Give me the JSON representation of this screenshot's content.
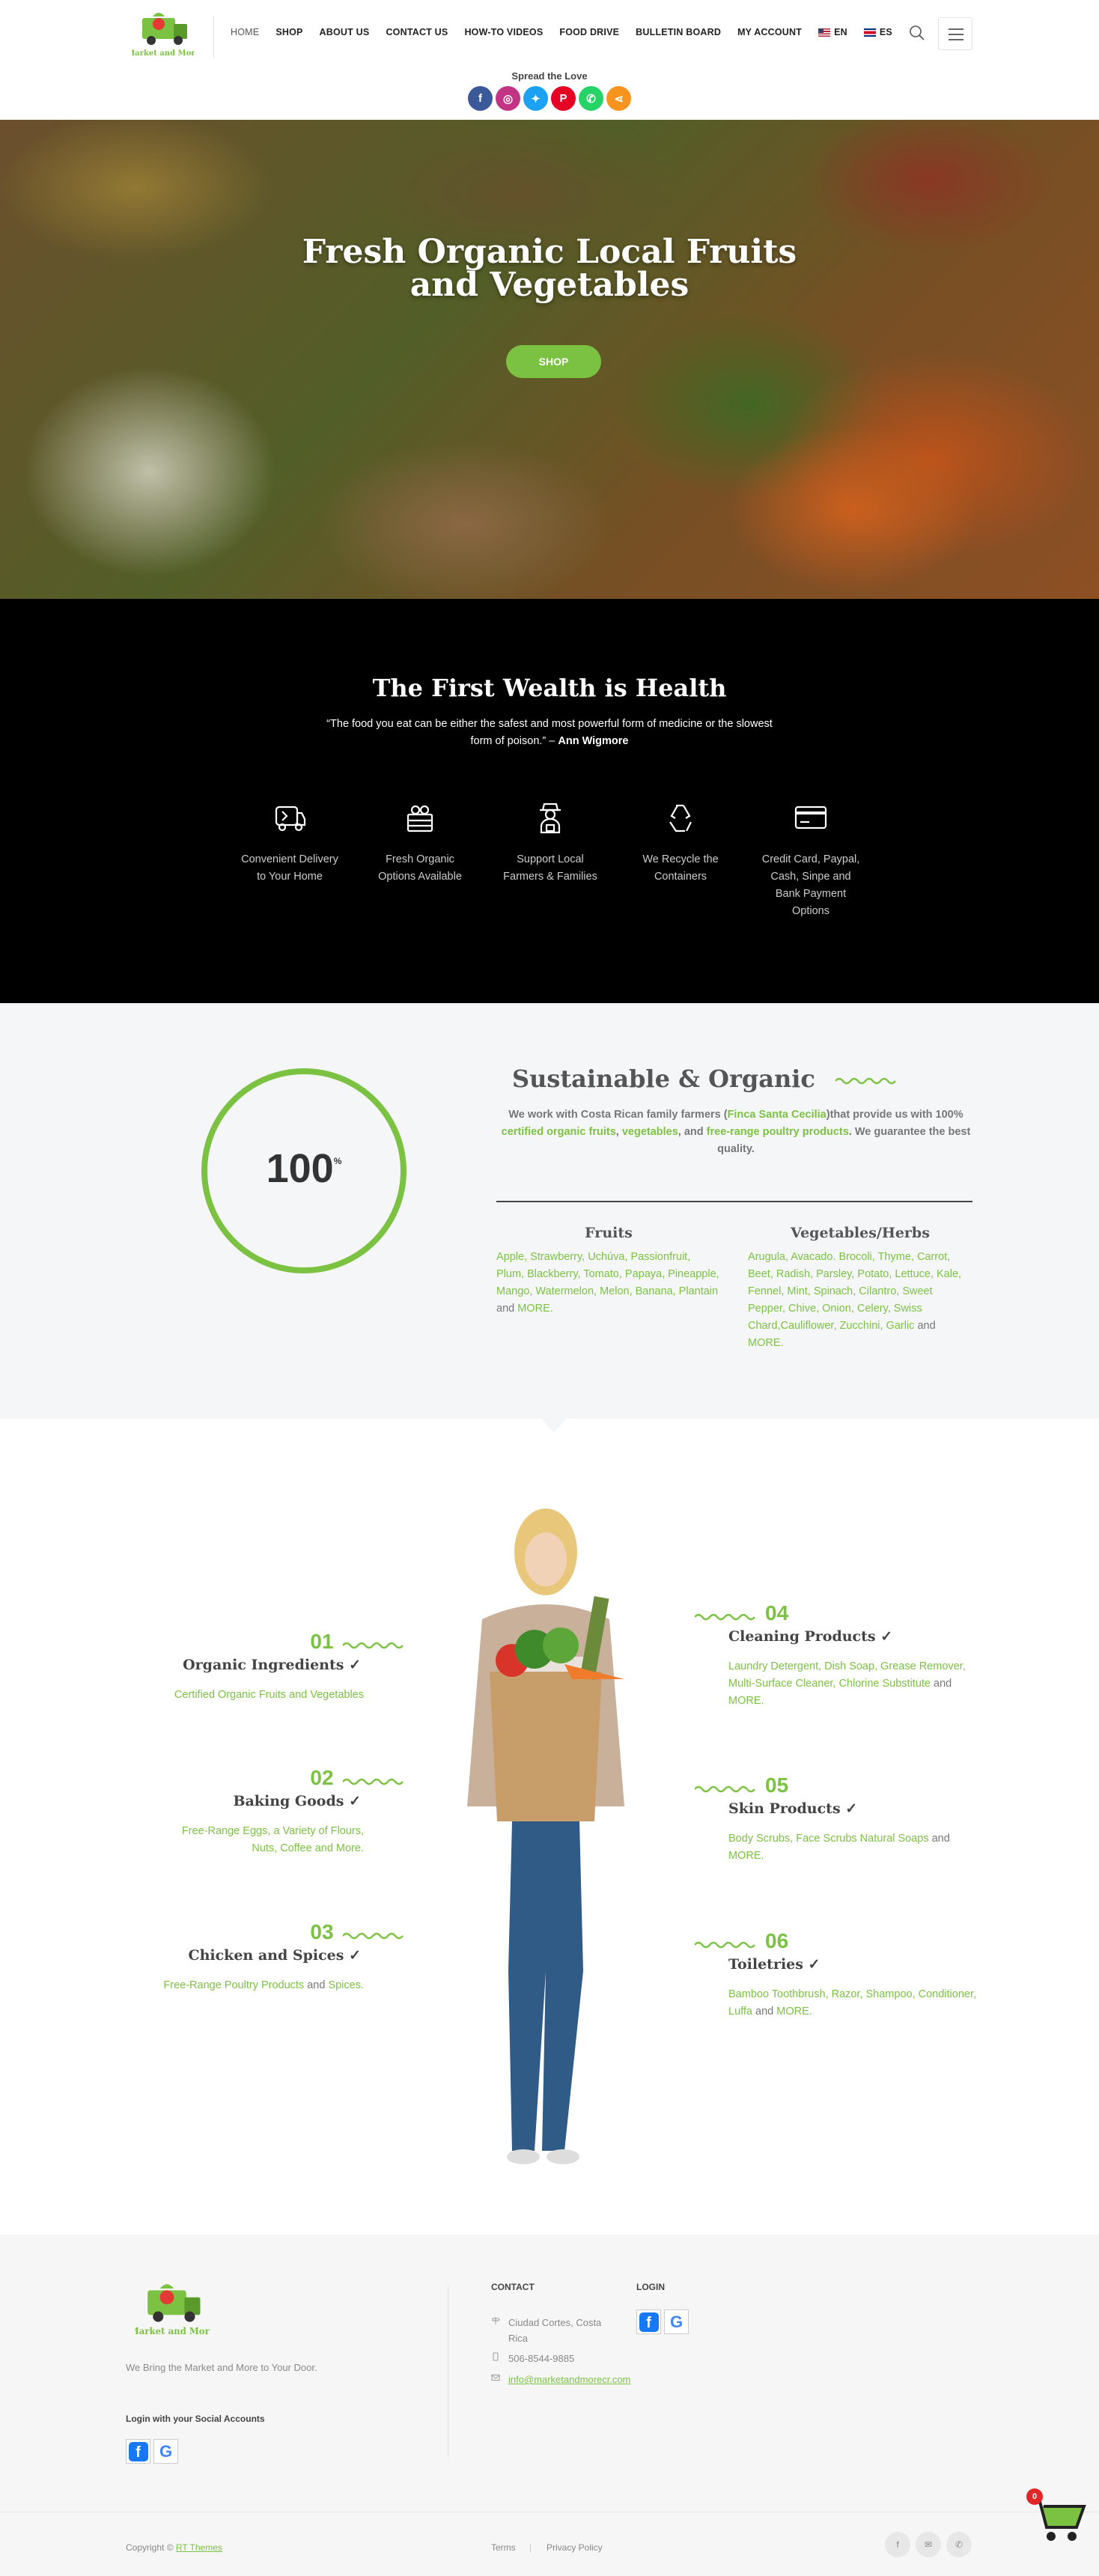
{
  "header": {
    "logo_text": "Market and More",
    "nav": [
      "HOME",
      "SHOP",
      "ABOUT US",
      "CONTACT US",
      "HOW-TO VIDEOS",
      "FOOD DRIVE",
      "BULLETIN BOARD",
      "MY ACCOUNT"
    ],
    "lang_en": "EN",
    "lang_es": "ES"
  },
  "share": {
    "label": "Spread the Love",
    "icons": [
      "facebook-icon",
      "instagram-icon",
      "twitter-icon",
      "pinterest-icon",
      "whatsapp-icon",
      "share-icon"
    ],
    "colors": [
      "#3b5998",
      "#c13584",
      "#1da1f2",
      "#e60023",
      "#25d366",
      "#f7941d"
    ]
  },
  "hero": {
    "title_line1": "Fresh Organic Local Fruits",
    "title_line2": "and Vegetables",
    "button": "SHOP"
  },
  "health": {
    "title": "The First Wealth is Health",
    "quote": "“The food you eat can be either the safest and most powerful form of medicine or the slowest form of poison.” – ",
    "author": "Ann Wigmore",
    "features": [
      {
        "icon": "delivery-truck-icon",
        "label": "Convenient Delivery to Your Home"
      },
      {
        "icon": "produce-crate-icon",
        "label": "Fresh Organic Options Available"
      },
      {
        "icon": "farmer-icon",
        "label": "Support Local Farmers & Families"
      },
      {
        "icon": "recycle-icon",
        "label": "We Recycle the Containers"
      },
      {
        "icon": "credit-card-icon",
        "label": "Credit Card, Paypal, Cash, Sinpe and Bank Payment Options"
      }
    ]
  },
  "sustainable": {
    "percent": 100,
    "percent_sign": "%",
    "title": "Sustainable & Organic",
    "text_1": "We work with Costa Rican family farmers (",
    "text_link1": "Finca Santa Cecilia",
    "text_2": ")that provide us with 100% ",
    "text_link2": "certified organic fruits",
    "text_3": ", ",
    "text_link3": "vegetables",
    "text_4": ", and ",
    "text_link4": "free-range poultry products",
    "text_5": ". We guarantee the best quality.",
    "fruits_title": "Fruits",
    "fruits": "Apple, Strawberry, Uchúva, Passionfruit, Plum, Blackberry, Tomato, Papaya, Pineapple, Mango, Watermelon, Melon, Banana, Plantain",
    "fruits_and": " and ",
    "fruits_more": "MORE.",
    "veg_title": "Vegetables/Herbs",
    "veg": "Arugula, Avacado. Brocoli, Thyme, Carrot, Beet, Radish, Parsley, Potato, Lettuce, Kale, Fennel, Mint, Spinach, Cilantro, Sweet Pepper, Chive, Onion, Celery, Swiss Chard,Cauliflower, Zucchini, Garlic",
    "veg_and": " and ",
    "veg_more": "MORE."
  },
  "products": [
    {
      "num": "01",
      "title": "Organic Ingredients ✓",
      "desc": "Certified Organic Fruits and Vegetables",
      "and": "",
      "more": ""
    },
    {
      "num": "02",
      "title": "Baking Goods ✓",
      "desc": "Free-Range Eggs, a Variety of Flours, Nuts, Coffee and More.",
      "and": "",
      "more": ""
    },
    {
      "num": "03",
      "title": "Chicken and Spices ✓",
      "desc": "Free-Range Poultry Products",
      "and": " and ",
      "more": "Spices."
    },
    {
      "num": "04",
      "title": "Cleaning Products ✓",
      "desc": "Laundry Detergent, Dish Soap, Grease Remover, Multi-Surface Cleaner, Chlorine Substitute",
      "and": " and ",
      "more": "MORE."
    },
    {
      "num": "05",
      "title": "Skin Products ✓",
      "desc": "Body Scrubs, Face Scrubs  Natural Soaps",
      "and": " and ",
      "more": "MORE."
    },
    {
      "num": "06",
      "title": "Toiletries ✓",
      "desc": "Bamboo Toothbrush, Razor, Shampoo, Conditioner, Luffa",
      "and": " and ",
      "more": "MORE."
    }
  ],
  "footer": {
    "logo_text": "Market and More",
    "tagline": "We Bring the Market and More to Your Door.",
    "social_login": "Login with your Social Accounts",
    "contact_title": "CONTACT",
    "address": "Ciudad Cortes, Costa Rica",
    "phone": "506-8544-9885",
    "email": "info@marketandmorecr.com",
    "login_title": "LOGIN",
    "copyright": "Copyright © ",
    "copyright_link": "RT Themes",
    "terms": "Terms",
    "privacy": "Privacy Policy",
    "cart_count": "0"
  },
  "colors": {
    "accent": "#7cc242",
    "dark": "#000000",
    "light_bg": "#f5f6f7"
  }
}
